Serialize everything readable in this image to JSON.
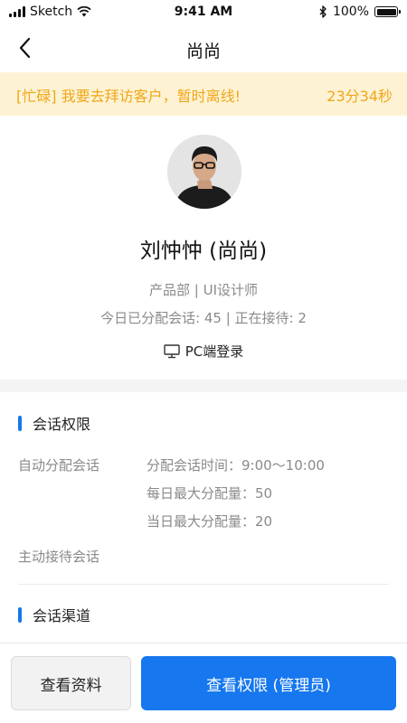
{
  "status_bar": {
    "carrier": "Sketch",
    "time": "9:41 AM",
    "battery": "100%"
  },
  "nav": {
    "title": "尚尚"
  },
  "banner": {
    "message": "[忙碌] 我要去拜访客户，暂时离线!",
    "timer": "23分34秒"
  },
  "profile": {
    "name": "刘忡忡 (尚尚)",
    "dept_role": "产品部 | UI设计师",
    "stats": "今日已分配会话: 45 | 正在接待: 2",
    "login_device": "PC端登录"
  },
  "permissions": {
    "section_title": "会话权限",
    "auto_label": "自动分配会话",
    "auto_details": [
      "分配会话时间：9:00～10:00",
      "每日最大分配量：50",
      "当日最大分配量：20"
    ],
    "active_label": "主动接待会话"
  },
  "channels": {
    "section_title": "会话渠道"
  },
  "actions": {
    "view_profile": "查看资料",
    "view_permissions": "查看权限 (管理员)"
  },
  "colors": {
    "accent": "#1677ee",
    "banner_bg": "#fdf3d4",
    "banner_text": "#f1a619",
    "muted_text": "#8a8a8a"
  }
}
